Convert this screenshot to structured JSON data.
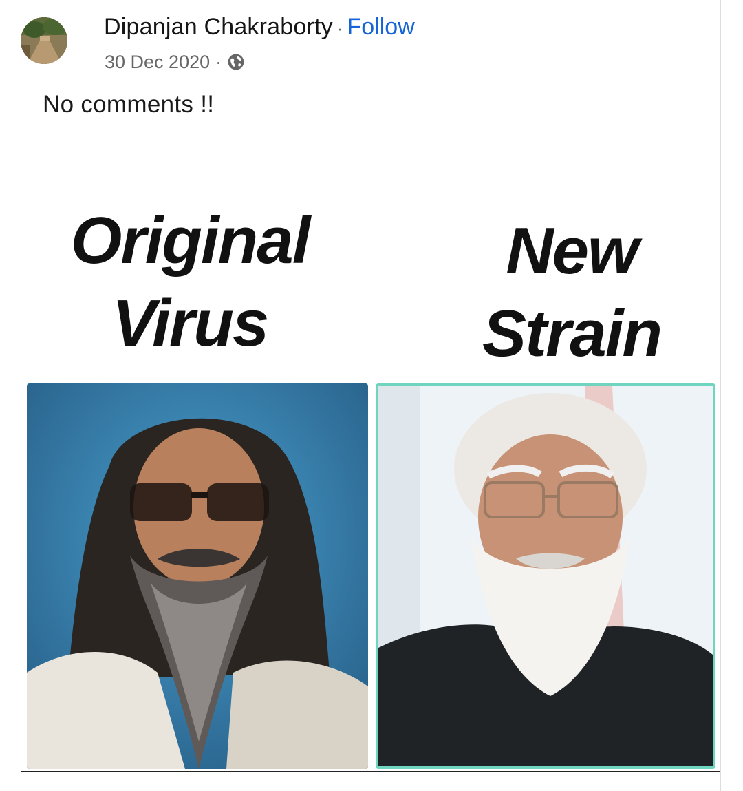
{
  "post": {
    "author_name": "Dipanjan Chakraborty",
    "separator": "·",
    "follow_label": "Follow",
    "date": "30 Dec 2020",
    "date_separator": "·",
    "privacy_icon": "globe-icon",
    "text": "No comments !!"
  },
  "meme": {
    "left_caption_line1": "Original",
    "left_caption_line2": "Virus",
    "right_caption_line1": "New",
    "right_caption_line2": "Strain"
  },
  "colors": {
    "follow": "#1565d8",
    "meta_text": "#666666",
    "right_photo_border": "#6fd5bf"
  }
}
